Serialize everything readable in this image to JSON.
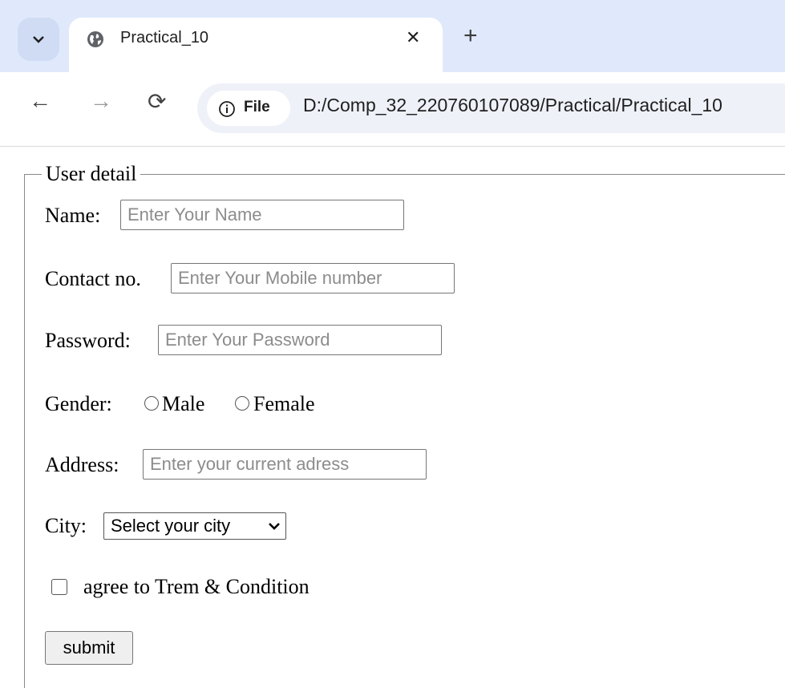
{
  "browser": {
    "tab_title": "Practical_10",
    "chip_label": "File",
    "url": "D:/Comp_32_220760107089/Practical/Practical_10"
  },
  "form": {
    "legend": "User detail",
    "name_label": "Name:",
    "name_placeholder": "Enter Your Name",
    "contact_label": "Contact no.",
    "contact_placeholder": "Enter Your Mobile number",
    "password_label": "Password:",
    "password_placeholder": "Enter Your Password",
    "gender_label": "Gender:",
    "gender_options": [
      "Male",
      "Female"
    ],
    "address_label": "Address:",
    "address_placeholder": "Enter your current adress",
    "city_label": "City:",
    "city_selected": "Select your city",
    "agree_label": "agree to Trem & Condition",
    "submit_label": "submit"
  }
}
